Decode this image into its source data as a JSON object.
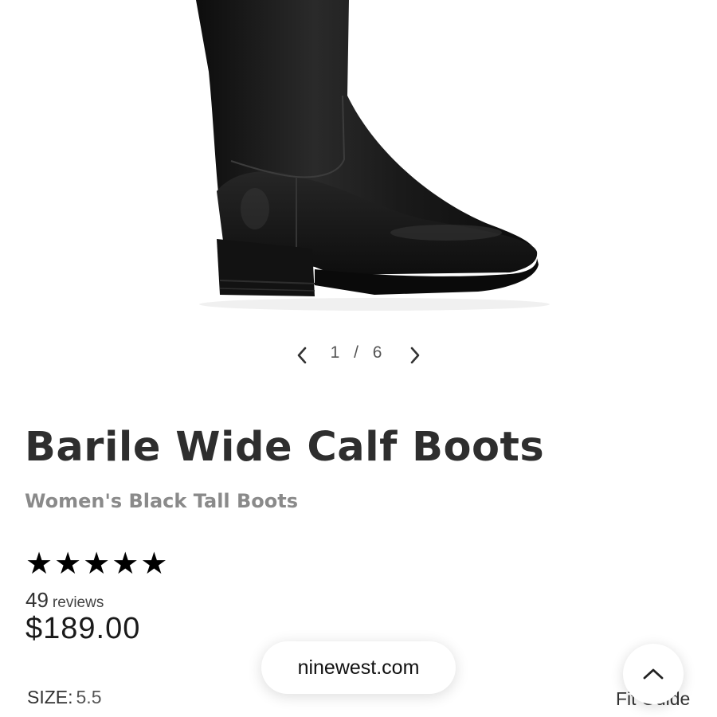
{
  "gallery": {
    "counter": "1 / 6",
    "prev_icon": "chevron-left-icon",
    "next_icon": "chevron-right-icon"
  },
  "product": {
    "title": "Barile Wide Calf Boots",
    "subtitle": "Women's Black Tall Boots",
    "rating": 5,
    "rating_max": 5,
    "review_count": "49",
    "review_label": "reviews",
    "price": "$189.00"
  },
  "browser": {
    "url": "ninewest.com"
  },
  "size": {
    "label": "SIZE:",
    "value": "5.5",
    "fit_guide": "Fit Guide"
  },
  "colors": {
    "text_primary": "#2e2e2e",
    "text_secondary": "#8a8a8a",
    "boot": "#161616"
  }
}
